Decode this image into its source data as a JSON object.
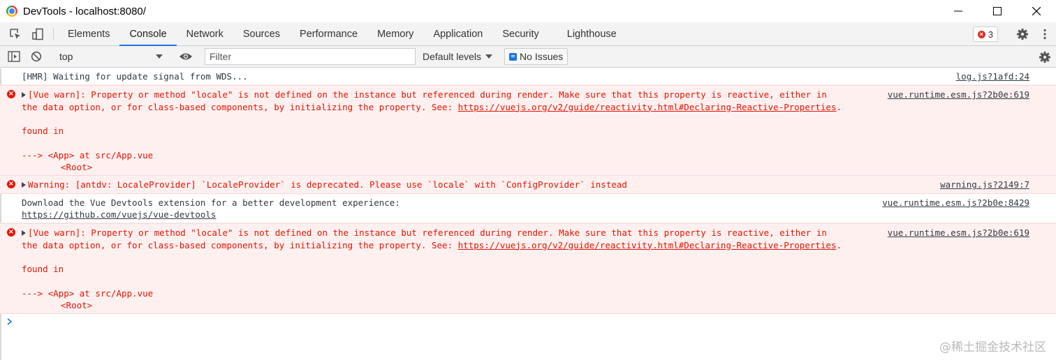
{
  "window": {
    "title": "DevTools - localhost:8080/"
  },
  "tabs": [
    {
      "label": "Elements"
    },
    {
      "label": "Console"
    },
    {
      "label": "Network"
    },
    {
      "label": "Sources"
    },
    {
      "label": "Performance"
    },
    {
      "label": "Memory"
    },
    {
      "label": "Application"
    },
    {
      "label": "Security"
    },
    {
      "label": "Lighthouse"
    }
  ],
  "error_count": "3",
  "toolbar": {
    "context": "top",
    "filter_placeholder": "Filter",
    "levels": "Default levels",
    "issues": "No Issues"
  },
  "messages": {
    "m1": {
      "text": "[HMR] Waiting for update signal from WDS...",
      "source": "log.js?1afd:24"
    },
    "m2": {
      "line1": "[Vue warn]: Property or method \"locale\" is not defined on the instance but referenced during render. Make sure that this property is reactive, either in",
      "line2_prefix": "the data option, or for class-based components, by initializing the property. See: ",
      "link": "https://vuejs.org/v2/guide/reactivity.html#Declaring-Reactive-Properties",
      "line2_suffix": ".",
      "found": "found in",
      "app": "---> <App> at src/App.vue",
      "root": "<Root>",
      "source": "vue.runtime.esm.js?2b0e:619"
    },
    "m3": {
      "text": "Warning: [antdv: LocaleProvider] `LocaleProvider` is deprecated. Please use `locale` with `ConfigProvider` instead",
      "source": "warning.js?2149:7"
    },
    "m4": {
      "text": "Download the Vue Devtools extension for a better development experience:",
      "link": "https://github.com/vuejs/vue-devtools",
      "source": "vue.runtime.esm.js?2b0e:8429"
    },
    "m5": {
      "line1": "[Vue warn]: Property or method \"locale\" is not defined on the instance but referenced during render. Make sure that this property is reactive, either in",
      "line2_prefix": "the data option, or for class-based components, by initializing the property. See: ",
      "link": "https://vuejs.org/v2/guide/reactivity.html#Declaring-Reactive-Properties",
      "line2_suffix": ".",
      "found": "found in",
      "app": "---> <App> at src/App.vue",
      "root": "<Root>",
      "source": "vue.runtime.esm.js?2b0e:619"
    }
  },
  "watermark": "@稀土掘金技术社区",
  "colors": {
    "error_bg": "#fff0f0",
    "error_text": "#e51400",
    "accent": "#1a73e8"
  }
}
